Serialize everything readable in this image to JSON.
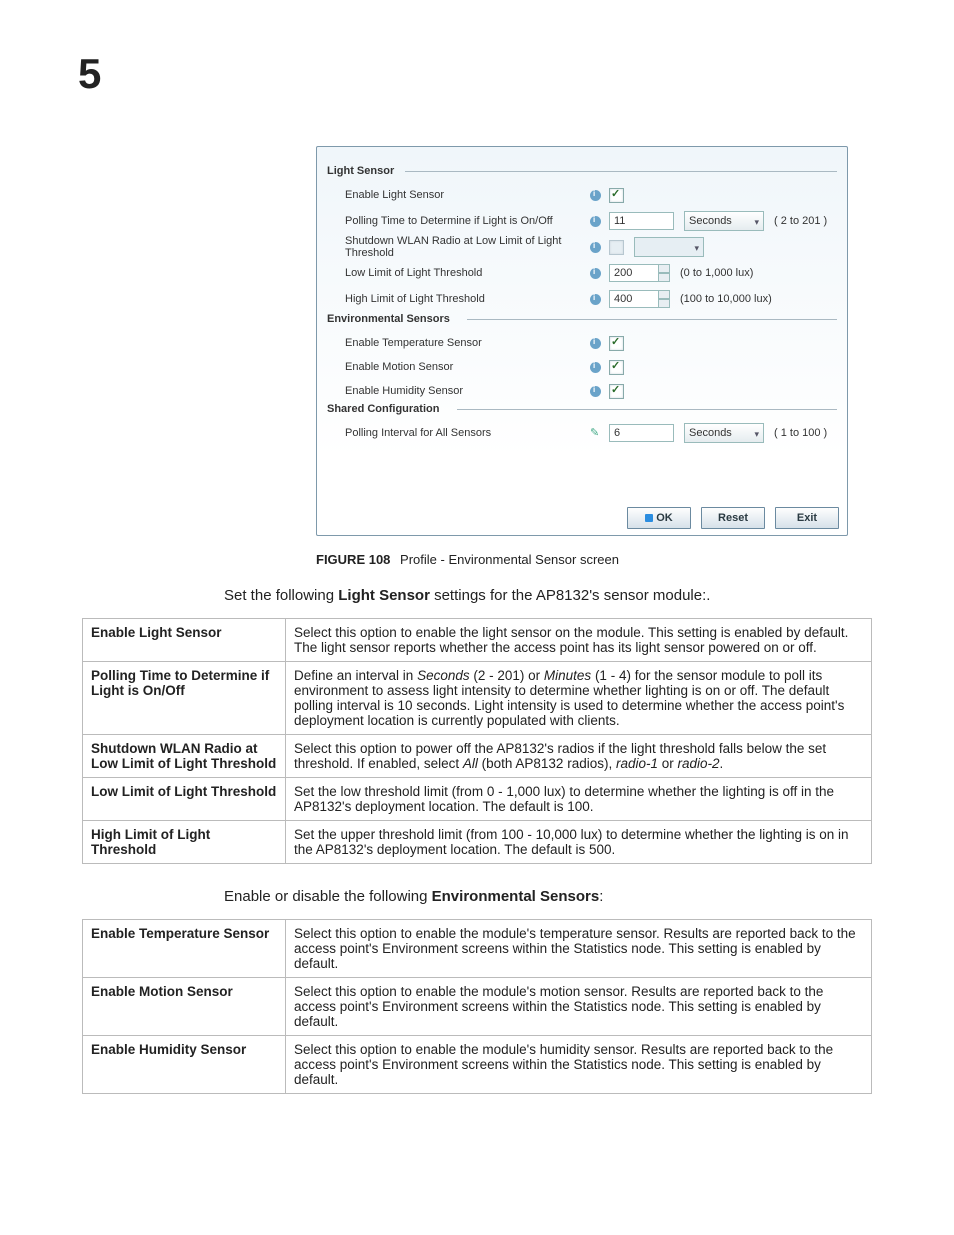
{
  "chapter_number": "5",
  "screenshot": {
    "sections": {
      "light": {
        "title": "Light Sensor",
        "enable_label": "Enable Light Sensor",
        "polling_label": "Polling Time to Determine if Light is On/Off",
        "polling_value": "11",
        "polling_unit": "Seconds",
        "polling_range": "( 2 to 201 )",
        "shutdown_label": "Shutdown WLAN Radio at Low Limit of Light Threshold",
        "low_label": "Low Limit of Light Threshold",
        "low_value": "200",
        "low_range": "(0 to 1,000 lux)",
        "high_label": "High Limit of Light Threshold",
        "high_value": "400",
        "high_range": "(100 to 10,000 lux)"
      },
      "env": {
        "title": "Environmental Sensors",
        "temp_label": "Enable Temperature Sensor",
        "motion_label": "Enable Motion Sensor",
        "humidity_label": "Enable Humidity Sensor"
      },
      "shared": {
        "title": "Shared Configuration",
        "polling_label": "Polling Interval for All Sensors",
        "polling_value": "6",
        "polling_unit": "Seconds",
        "polling_range": "( 1 to 100 )"
      }
    },
    "buttons": {
      "ok": "OK",
      "reset": "Reset",
      "exit": "Exit"
    }
  },
  "caption": {
    "label": "FIGURE 108",
    "text": "Profile - Environmental Sensor screen"
  },
  "intro1_pre": "Set the following ",
  "intro1_bold": "Light Sensor",
  "intro1_post": " settings for the AP8132's sensor module:.",
  "table1": [
    {
      "term": "Enable Light Sensor",
      "desc": "Select this option to enable the light sensor on the module. This setting is enabled by default. The light sensor reports whether the access point has its light sensor powered on or off."
    },
    {
      "term": "Polling Time to Determine if Light is On/Off",
      "desc": "Define an interval in <em>Seconds</em> (2 - 201) or <em>Minutes</em> (1 - 4) for the sensor module to poll its environment to assess light intensity to determine whether lighting is on or off. The default polling interval is 10 seconds. Light intensity is used to determine whether the access point's deployment location is currently populated with clients."
    },
    {
      "term": "Shutdown WLAN Radio at Low Limit of Light Threshold",
      "desc": "Select this option to power off the AP8132's radios if the light threshold falls below the set threshold. If enabled, select <em>All</em> (both AP8132 radios), <em>radio-1</em> or <em>radio-2</em>."
    },
    {
      "term": "Low Limit of Light Threshold",
      "desc": "Set the low threshold limit (from 0 - 1,000 lux) to determine whether the lighting is off in the AP8132's deployment location. The default is 100."
    },
    {
      "term": "High Limit of Light Threshold",
      "desc": "Set the upper threshold limit (from 100 - 10,000 lux) to determine whether the lighting is on in the AP8132's deployment location. The default is 500."
    }
  ],
  "intro2_pre": "Enable or disable the following ",
  "intro2_bold": "Environmental Sensors",
  "intro2_post": ":",
  "table2": [
    {
      "term": "Enable Temperature Sensor",
      "desc": "Select this option to enable the module's temperature sensor. Results are reported back to the access point's Environment screens within the Statistics node. This setting is enabled by default."
    },
    {
      "term": "Enable Motion Sensor",
      "desc": "Select this option to enable the module's motion sensor. Results are reported back to the access point's Environment screens within the Statistics node. This setting is enabled by default."
    },
    {
      "term": "Enable Humidity Sensor",
      "desc": "Select this option to enable the module's humidity sensor. Results are reported back to the access point's Environment screens within the Statistics node. This setting is enabled by default."
    }
  ]
}
